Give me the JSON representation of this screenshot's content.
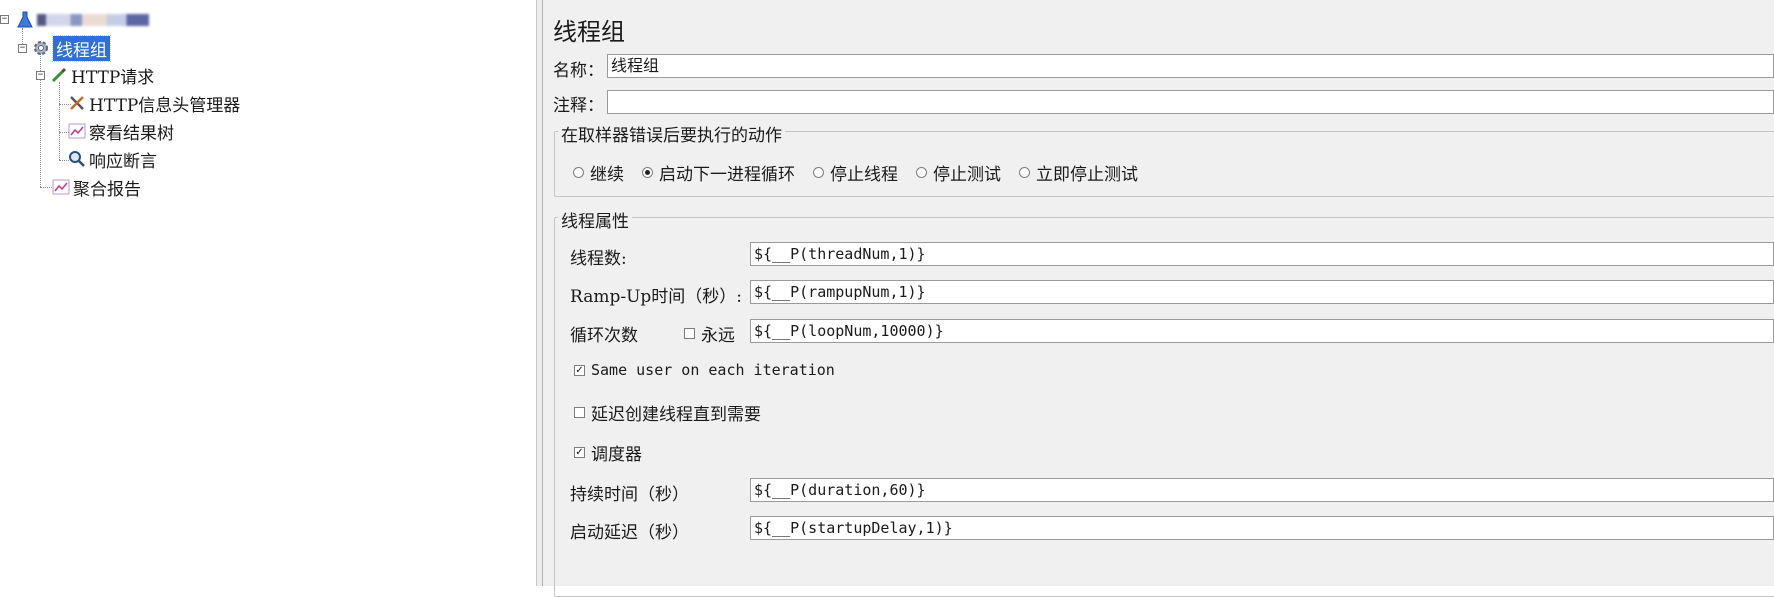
{
  "tree": {
    "root_name_obscured": "",
    "items": [
      {
        "label": "线程组",
        "icon": "gear-icon"
      },
      {
        "label": "HTTP请求",
        "icon": "pipette-icon"
      },
      {
        "label": "HTTP信息头管理器",
        "icon": "wrench-screwdriver-icon"
      },
      {
        "label": "察看结果树",
        "icon": "graph-icon"
      },
      {
        "label": "响应断言",
        "icon": "magnifier-icon"
      },
      {
        "label": "聚合报告",
        "icon": "graph-icon"
      }
    ]
  },
  "panel": {
    "title": "线程组",
    "name_label": "名称：",
    "name_value": "线程组",
    "comment_label": "注释：",
    "comment_value": "",
    "error_action": {
      "title": "在取样器错误后要执行的动作",
      "options": [
        "继续",
        "启动下一进程循环",
        "停止线程",
        "停止测试",
        "立即停止测试"
      ],
      "selected": "启动下一进程循环"
    },
    "thread_props": {
      "title": "线程属性",
      "threads_label": "线程数:",
      "threads_value": "${__P(threadNum,1)}",
      "rampup_label": "Ramp-Up时间（秒）:",
      "rampup_value": "${__P(rampupNum,1)}",
      "loop_label": "循环次数",
      "forever_label": "永远",
      "forever_checked": false,
      "loop_value": "${__P(loopNum,10000)}",
      "same_user_label": "Same user on each iteration",
      "same_user_checked": true,
      "delay_create_label": "延迟创建线程直到需要",
      "delay_create_checked": false,
      "scheduler_label": "调度器",
      "scheduler_checked": true,
      "duration_label": "持续时间（秒）",
      "duration_value": "${__P(duration,60)}",
      "startup_delay_label": "启动延迟（秒）",
      "startup_delay_value": "${__P(startupDelay,1)}"
    }
  }
}
